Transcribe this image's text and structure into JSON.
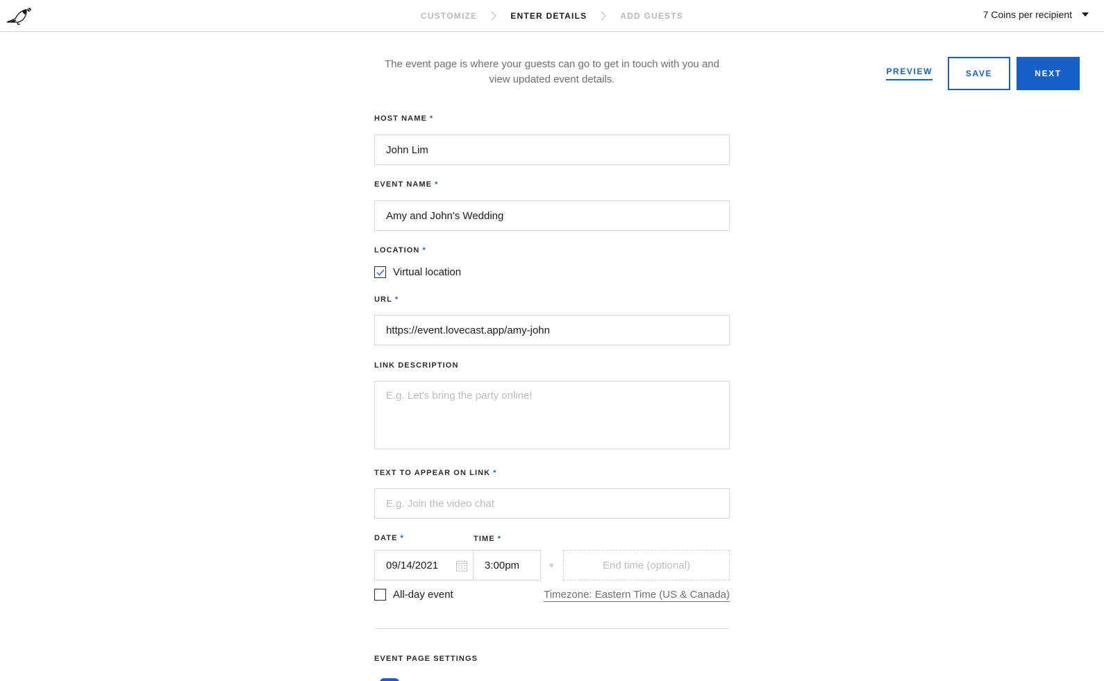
{
  "header": {
    "logo": "pigeon-logo",
    "steps": [
      {
        "label": "CUSTOMIZE",
        "state": "inactive"
      },
      {
        "label": "ENTER DETAILS",
        "state": "active"
      },
      {
        "label": "ADD GUESTS",
        "state": "inactive"
      }
    ],
    "coins_selector": "7 Coins per recipient"
  },
  "intro_text": "The event page is where your guests can go to get in touch with you and view updated event details.",
  "actions": {
    "preview_label": "PREVIEW",
    "save_label": "SAVE",
    "next_label": "NEXT"
  },
  "form": {
    "host_name": {
      "label": "HOST NAME",
      "required_mark": "*",
      "value": "John Lim"
    },
    "event_name": {
      "label": "EVENT NAME",
      "required_mark": "*",
      "value": "Amy and John's Wedding"
    },
    "location": {
      "label": "LOCATION",
      "required_mark": "*",
      "virtual_label": "Virtual location",
      "virtual_checked": true
    },
    "url": {
      "label": "URL",
      "required_mark": "*",
      "value": "https://event.lovecast.app/amy-john"
    },
    "link_description": {
      "label": "LINK DESCRIPTION",
      "value": "",
      "placeholder": "E.g. Let's bring the party online!"
    },
    "link_text": {
      "label": "TEXT TO APPEAR ON LINK",
      "required_mark": "*",
      "value": "",
      "placeholder": "E.g. Join the video chat"
    },
    "date": {
      "label": "DATE",
      "required_mark": "*",
      "value": "09/14/2021"
    },
    "time": {
      "label": "TIME",
      "required_mark": "*",
      "value": "3:00pm"
    },
    "end_time": {
      "placeholder": "End time (optional)"
    },
    "all_day": {
      "label": "All-day event",
      "checked": false
    },
    "timezone": "Timezone: Eastern Time (US & Canada)"
  },
  "section": {
    "event_page_settings": "EVENT PAGE SETTINGS"
  },
  "colors": {
    "accent": "#1760c8",
    "muted_text": "#6f6f6f",
    "border": "#d9d9d9"
  }
}
